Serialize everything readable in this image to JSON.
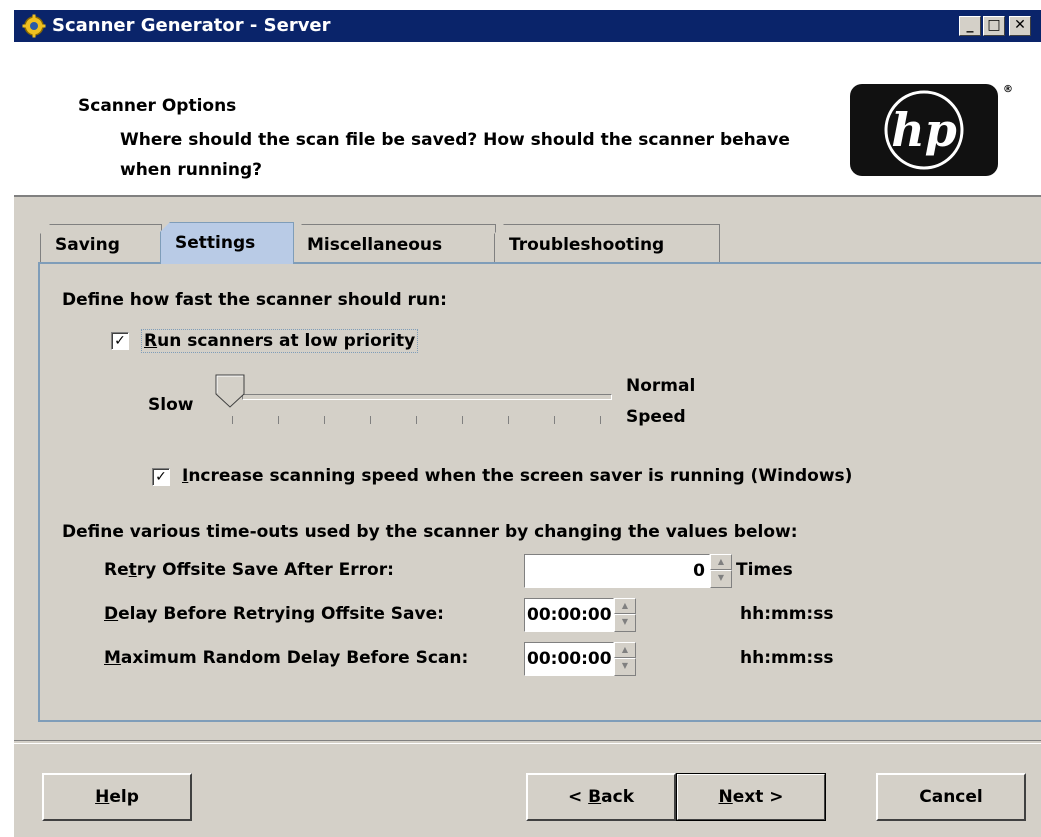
{
  "window": {
    "title": "Scanner Generator - Server",
    "controls": {
      "minimize": "_",
      "maximize": "□",
      "close": "✕"
    }
  },
  "header": {
    "title": "Scanner Options",
    "subtitle": "Where should the scan file be saved?  How should the scanner behave when running?",
    "logo_text": "hp",
    "logo_reg": "®"
  },
  "tabs": [
    {
      "label": "Saving",
      "active": false
    },
    {
      "label": "Settings",
      "active": true
    },
    {
      "label": "Miscellaneous",
      "active": false
    },
    {
      "label": "Troubleshooting",
      "active": false
    }
  ],
  "settings": {
    "speed_heading": "Define how fast the scanner should run:",
    "low_priority": {
      "label_mnemonic": "R",
      "label_rest": "un scanners at low priority",
      "checked": true,
      "checkmark": "✓"
    },
    "slider": {
      "min_label": "Slow",
      "max_label_line1": "Normal",
      "max_label_line2": "Speed",
      "value": 0
    },
    "screensaver": {
      "label_mnemonic": "I",
      "label_rest": "ncrease scanning speed when the screen saver is running (Windows)",
      "checked": true,
      "checkmark": "✓"
    },
    "timeouts_heading": "Define various time-outs used by the scanner by changing the values below:",
    "retry": {
      "label_pre": "Re",
      "label_mnemonic": "t",
      "label_post": "ry Offsite Save After Error:",
      "value": "0",
      "unit": "Times"
    },
    "delay_retry": {
      "label_mnemonic": "D",
      "label_rest": "elay Before Retrying Offsite Save:",
      "value": "00:00:00",
      "unit": "hh:mm:ss"
    },
    "max_random": {
      "label_mnemonic": "M",
      "label_rest": "aximum Random Delay Before Scan:",
      "value": "00:00:00",
      "unit": "hh:mm:ss"
    }
  },
  "buttons": {
    "help": {
      "mnemonic": "H",
      "rest": "elp"
    },
    "back": {
      "pre": "< ",
      "mnemonic": "B",
      "rest": "ack"
    },
    "next": {
      "mnemonic": "N",
      "rest": "ext >"
    },
    "cancel": {
      "label": "Cancel"
    }
  },
  "spinner_arrows": {
    "up": "▲",
    "down": "▼"
  }
}
